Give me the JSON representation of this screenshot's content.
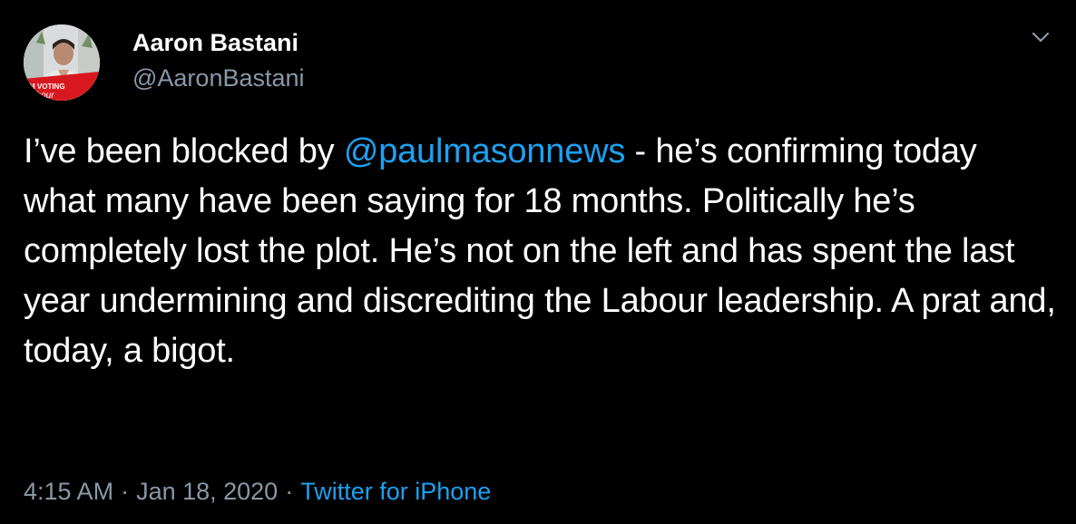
{
  "tweet": {
    "author": {
      "name": "Aaron Bastani",
      "handle": "@AaronBastani",
      "avatar_badge_line1": "M VOTING",
      "avatar_badge_line2": "abour"
    },
    "body": {
      "part1": "I’ve been blocked by ",
      "mention": "@paulmasonnews",
      "part2": " - he’s confirming today what many have been saying for 18 months. Politically he’s completely lost the plot. He’s not on the left and has spent the last year undermining and discrediting the Labour leadership. A prat and, today, a bigot."
    },
    "meta": {
      "time": "4:15 AM",
      "separator": "·",
      "date": "Jan 18, 2020",
      "separator2": "·",
      "source": "Twitter for iPhone"
    },
    "icons": {
      "menu": "chevron-down-icon"
    },
    "colors": {
      "background": "#000000",
      "text": "#ffffff",
      "secondary": "#8899a6",
      "link": "#1da1f2",
      "badge": "#d7191f"
    }
  }
}
